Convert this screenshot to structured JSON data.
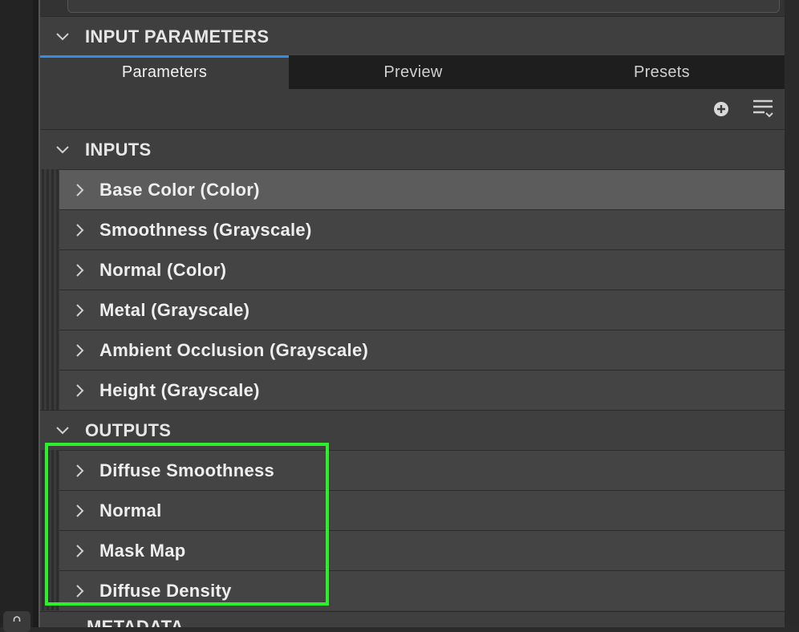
{
  "sections": {
    "input_parameters": "INPUT PARAMETERS",
    "inputs": "INPUTS",
    "outputs": "OUTPUTS",
    "metadata": "METADATA"
  },
  "tabs": {
    "parameters": "Parameters",
    "preview": "Preview",
    "presets": "Presets",
    "active": "Parameters"
  },
  "toolbar": {
    "icons": [
      "add-circle-icon",
      "list-menu-icon"
    ]
  },
  "inputs": [
    {
      "label": "Base Color (Color)",
      "selected": true
    },
    {
      "label": "Smoothness (Grayscale)"
    },
    {
      "label": "Normal (Color)"
    },
    {
      "label": "Metal (Grayscale)"
    },
    {
      "label": "Ambient Occlusion (Grayscale)"
    },
    {
      "label": "Height (Grayscale)"
    }
  ],
  "outputs": [
    {
      "label": "Diffuse Smoothness"
    },
    {
      "label": "Normal"
    },
    {
      "label": "Mask Map"
    },
    {
      "label": "Diffuse Density"
    }
  ],
  "colors": {
    "accent_tab": "#2f8fe6",
    "highlight": "#2cf02c",
    "panel_bg": "#3c3c3c",
    "row_bg": "#444444",
    "row_selected_bg": "#5c5c5c"
  }
}
